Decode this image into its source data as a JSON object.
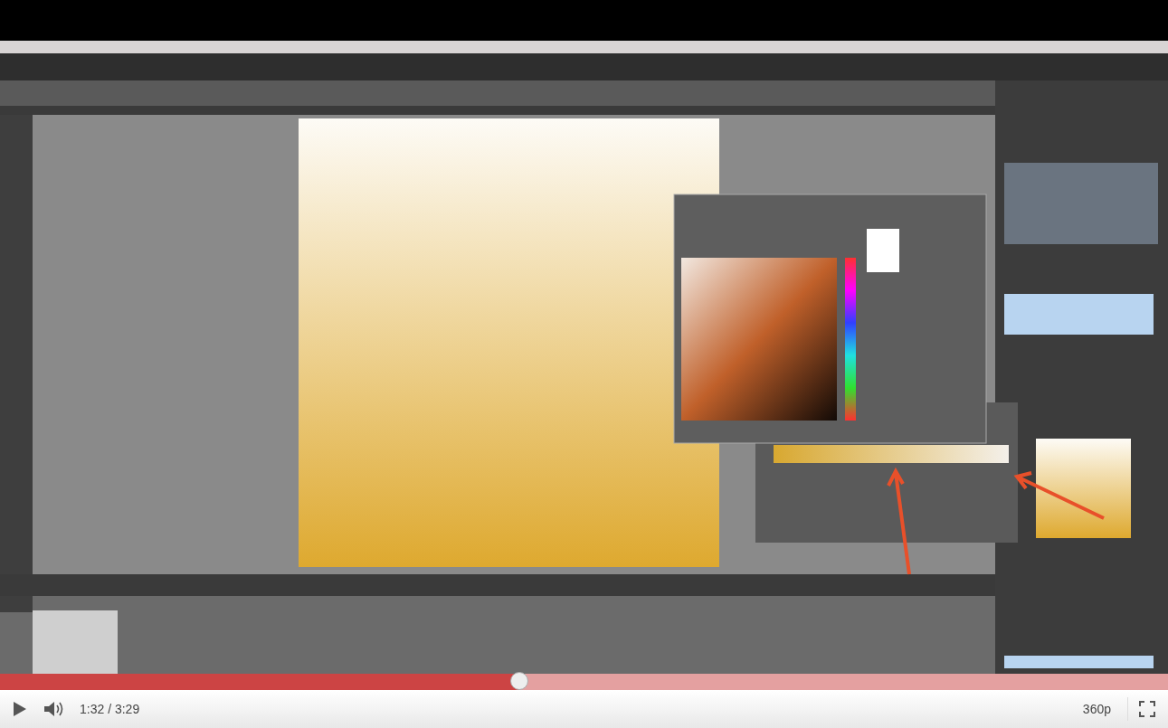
{
  "player": {
    "progress": {
      "level": 0.445
    },
    "time": "1:32 / 3:29",
    "quality": "360p"
  }
}
